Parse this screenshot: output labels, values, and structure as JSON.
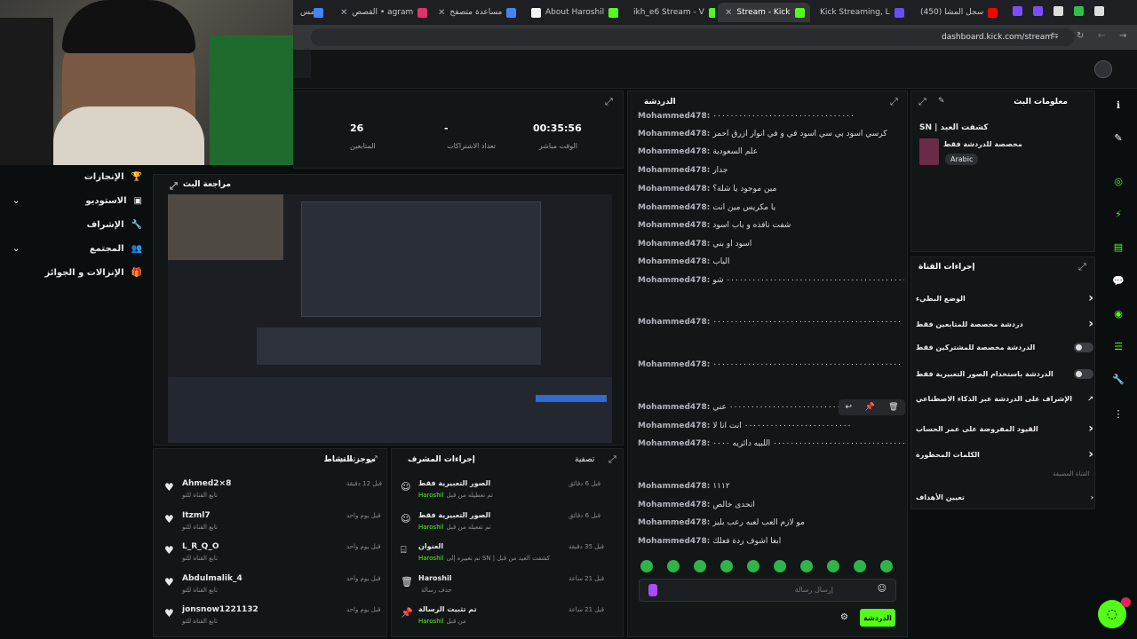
{
  "browser": {
    "tabs": [
      {
        "label": "مس",
        "active": false
      },
      {
        "label": "القصص • agram",
        "active": false
      },
      {
        "label": "مساعدة متصفح",
        "active": false
      },
      {
        "label": "About Haroshil",
        "active": false
      },
      {
        "label": "ikh_e6 Stream - V",
        "active": false
      },
      {
        "label": "Stream - Kick",
        "active": true
      },
      {
        "label": "Kick Streaming, L",
        "active": false
      },
      {
        "label": "(450) سجل المشا",
        "active": false
      }
    ],
    "url": "dashboard.kick.com/stream"
  },
  "sidebar": {
    "items": [
      {
        "label": "الإنجازات",
        "icon": "trophy-icon"
      },
      {
        "label": "الاستوديو",
        "icon": "studio-icon"
      },
      {
        "label": "الإشراف",
        "icon": "wrench-icon"
      },
      {
        "label": "المجتمع",
        "icon": "community-icon"
      },
      {
        "label": "الإنزالات و الجوائز",
        "icon": "gift-icon"
      }
    ]
  },
  "stats": {
    "uptime_value": "00:35:56",
    "uptime_label": "الوقت مباشر",
    "subs_value": "-",
    "subs_label": "تعداد الاشتراكات",
    "followers_value": "26",
    "followers_label": "المتابعين"
  },
  "preview": {
    "title": "مراجعة البث"
  },
  "chat": {
    "title": "الدردشة",
    "messages": [
      {
        "user": "Mohammed478:",
        "text": "٠٠٠٠٠٠٠٠٠٠٠٠٠٠٠٠٠٠٠٠٠٠٠٠٠٠٠٠٠٠٠٠٠"
      },
      {
        "user": "Mohammed478:",
        "text": "كرسي اسود بي سي اسود في و في انوار ازرق احمر"
      },
      {
        "user": "Mohammed478:",
        "text": "علم السعودية"
      },
      {
        "user": "Mohammed478:",
        "text": "جدار"
      },
      {
        "user": "Mohammed478:",
        "text": "مين موجود يا شلة؟"
      },
      {
        "user": "Mohammed478:",
        "text": "يا مكريس مين انت"
      },
      {
        "user": "Mohammed478:",
        "text": "شفت نافذه و باب اسود"
      },
      {
        "user": "Mohammed478:",
        "text": "اسود أو بني"
      },
      {
        "user": "Mohammed478:",
        "text": "الباب"
      },
      {
        "user": "Mohammed478:",
        "text": "٠٠٠٠٠٠٠٠٠٠٠٠٠٠٠٠٠٠٠٠٠٠٠٠٠٠٠٠٠٠٠٠٠٠٠٠٠٠٠٠٠٠٠٠٠٠٠٠٠٠٠٠ شو"
      },
      {
        "user": "Mohammed478:",
        "text": "شسالفه ٠٠٠٠٠٠٠٠٠٠٠٠٠٠٠٠٠٠٠٠٠٠٠٠٠٠٠٠٠٠٠٠٠٠٠٠٠٠٠٠٠٠٠٠"
      },
      {
        "user": "Mohammed478:",
        "text": "متري ٠٠٠٠٠٠٠٠٠٠٠٠٠٠٠٠٠٠٠٠٠٠٠٠٠٠٠٠٠٠٠٠٠٠٠٠٠٠٠٠٠٠٠٠"
      },
      {
        "user": "Mohammed478:",
        "text": "٠٠٠٠٠٠٠٠٠٠٠٠٠٠٠٠٠٠٠٠٠٠٠٠٠٠ عني"
      },
      {
        "user": "Mohammed478:",
        "text": "٠٠٠٠٠٠٠٠٠٠٠٠٠٠٠٠٠٠٠٠٠٠٠٠٠ انت انا لا"
      },
      {
        "user": "Mohammed478:",
        "text": "٠٠٠٠٠٠٠٠٠٠٠٠٠٠٠٠٠٠٠٠٠٠٠٠٠٠٠٠٠٠٠٠٠٠٠ اللبيه دائريه ٠٠٠٠"
      },
      {
        "user": "Mohammed478:",
        "text": "١١١٢"
      },
      {
        "user": "Mohammed478:",
        "text": "اتحدى خالص"
      },
      {
        "user": "Mohammed478:",
        "text": "مو لازم العب لعبه رعب بليز"
      },
      {
        "user": "Mohammed478:",
        "text": "ابغا اشوف ردة فعلك"
      }
    ],
    "input_placeholder": "إرسال رسالة",
    "send_label": "الدردشة"
  },
  "stream_info": {
    "title": "معلومات البث",
    "stream_title": "SN | كشفت العيد",
    "category": "مخصصة للدردشة فقط",
    "language": "Arabic"
  },
  "channel_actions": {
    "title": "إجراءات القناة",
    "options": [
      {
        "label": "الوضع البطيء",
        "control": "chevron"
      },
      {
        "label": "دردشة مخصصة للمتابعين فقط",
        "control": "chevron"
      },
      {
        "label": "الدردشة مخصصة للمشتركين فقط",
        "control": "toggle"
      },
      {
        "label": "الدردشة باستخدام الصور التعبيرية فقط",
        "control": "toggle"
      },
      {
        "label": "الإشراف على الدردشة عبر الذكاء الاصطناعي",
        "control": "external"
      },
      {
        "label": "القيود المفروضة على عمر الحساب",
        "control": "chevron"
      },
      {
        "label": "الكلمات المحظورة",
        "control": "chevron"
      }
    ],
    "section_label": "القناة المضيفة",
    "goals_label": "تعيين الأهداف"
  },
  "mod_actions": {
    "title": "إجراءات المشرف",
    "filter": "تصفية",
    "items": [
      {
        "title": "الصور التعبيرية فقط",
        "desc": "تم تعطيله من قبل",
        "user": "Haroshil",
        "time": "قبل 6 دقائق"
      },
      {
        "title": "الصور التعبيرية فقط",
        "desc": "تم تفعيله من قبل",
        "user": "Haroshil",
        "time": "قبل 6 دقائق"
      },
      {
        "title": "العنوان",
        "desc": "تم تغييره إلى SN | كشفت العيد من قبل",
        "user": "Haroshil",
        "time": "قبل 35 دقيقة"
      },
      {
        "title": "Haroshil",
        "desc": "حذف رسالة",
        "user": "",
        "time": "قبل 21 ساعة"
      },
      {
        "title": "تم تثبيت الرسالة",
        "desc": "من قبل",
        "user": "Haroshil",
        "time": "قبل 21 ساعة"
      }
    ]
  },
  "activity": {
    "title": "موجز النشاط",
    "filter": "تصفية",
    "items": [
      {
        "user": "Ahmed2×8",
        "desc": "تابع القناة للتو",
        "time": "قبل 12 دقيقة"
      },
      {
        "user": "Itzml7",
        "desc": "تابع القناة للتو",
        "time": "قبل يوم واحد"
      },
      {
        "user": "L_R_Q_O",
        "desc": "تابع القناة للتو",
        "time": "قبل يوم واحد"
      },
      {
        "user": "Abdulmalik_4",
        "desc": "تابع القناة للتو",
        "time": "قبل يوم واحد"
      },
      {
        "user": "jonsnow1221132",
        "desc": "تابع القناة للتو",
        "time": "قبل يوم واحد"
      }
    ]
  },
  "colors": {
    "accent": "#53fc18",
    "bg": "#0b0e0f",
    "panel": "#131617"
  }
}
